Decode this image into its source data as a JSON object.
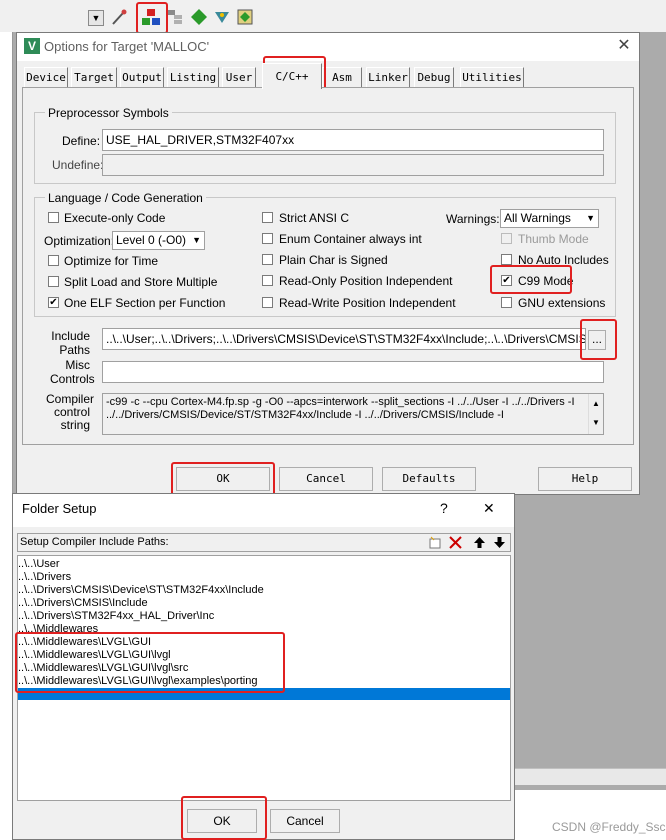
{
  "toolbar": {
    "icons": [
      "dropdown-arrow-icon",
      "wand-icon",
      "target-options-icon",
      "manage-icon",
      "diamond-icon",
      "debug-icon",
      "pack-icon"
    ]
  },
  "options_dialog": {
    "title": "Options for Target 'MALLOC'",
    "tabs": [
      "Device",
      "Target",
      "Output",
      "Listing",
      "User",
      "C/C++",
      "Asm",
      "Linker",
      "Debug",
      "Utilities"
    ],
    "active_tab": "C/C++",
    "preprocessor": {
      "group_title": "Preprocessor Symbols",
      "define_label": "Define:",
      "define_value": "USE_HAL_DRIVER,STM32F407xx",
      "undefine_label": "Undefine:",
      "undefine_value": ""
    },
    "language": {
      "group_title": "Language / Code Generation",
      "execute_only": "Execute-only Code",
      "optimization_label": "Optimization:",
      "optimization_value": "Level 0 (-O0)",
      "optimize_time": "Optimize for Time",
      "split_load": "Split Load and Store Multiple",
      "one_elf": "One ELF Section per Function",
      "strict_ansi": "Strict ANSI C",
      "enum_container": "Enum Container always int",
      "plain_char": "Plain Char is Signed",
      "ro_pos": "Read-Only Position Independent",
      "rw_pos": "Read-Write Position Independent",
      "warnings_label": "Warnings:",
      "warnings_value": "All Warnings",
      "thumb_mode": "Thumb Mode",
      "no_auto_includes": "No Auto Includes",
      "c99_mode": "C99 Mode",
      "gnu_ext": "GNU extensions"
    },
    "include_paths_label": "Include Paths",
    "include_paths_value": "..\\..\\User;..\\..\\Drivers;..\\..\\Drivers\\CMSIS\\Device\\ST\\STM32F4xx\\Include;..\\..\\Drivers\\CMSIS\\Inc",
    "browse_label": "...",
    "misc_label": "Misc Controls",
    "misc_value": "",
    "compiler_label": "Compiler control string",
    "compiler_line1": "-c99 -c --cpu Cortex-M4.fp.sp -g -O0 --apcs=interwork --split_sections -I ../../User -I ../../Drivers -I",
    "compiler_line2": "../../Drivers/CMSIS/Device/ST/STM32F4xx/Include -I ../../Drivers/CMSIS/Include -I",
    "buttons": {
      "ok": "OK",
      "cancel": "Cancel",
      "defaults": "Defaults",
      "help": "Help"
    }
  },
  "folder_dialog": {
    "title": "Folder Setup",
    "help_glyph": "?",
    "close_glyph": "✕",
    "list_header": "Setup Compiler Include Paths:",
    "paths": [
      "..\\..\\User",
      "..\\..\\Drivers",
      "..\\..\\Drivers\\CMSIS\\Device\\ST\\STM32F4xx\\Include",
      "..\\..\\Drivers\\CMSIS\\Include",
      "..\\..\\Drivers\\STM32F4xx_HAL_Driver\\Inc",
      "..\\..\\Middlewares",
      "..\\..\\Middlewares\\LVGL\\GUI",
      "..\\..\\Middlewares\\LVGL\\GUI\\lvgl",
      "..\\..\\Middlewares\\LVGL\\GUI\\lvgl\\src",
      "..\\..\\Middlewares\\LVGL\\GUI\\lvgl\\examples\\porting"
    ],
    "buttons": {
      "ok": "OK",
      "cancel": "Cancel"
    }
  },
  "watermark": "CSDN @Freddy_Ssc",
  "colors": {
    "highlight": "#e02020",
    "selection": "#0078d7",
    "dialog_bg": "#f0f0f0",
    "app_bg": "#ababab"
  }
}
